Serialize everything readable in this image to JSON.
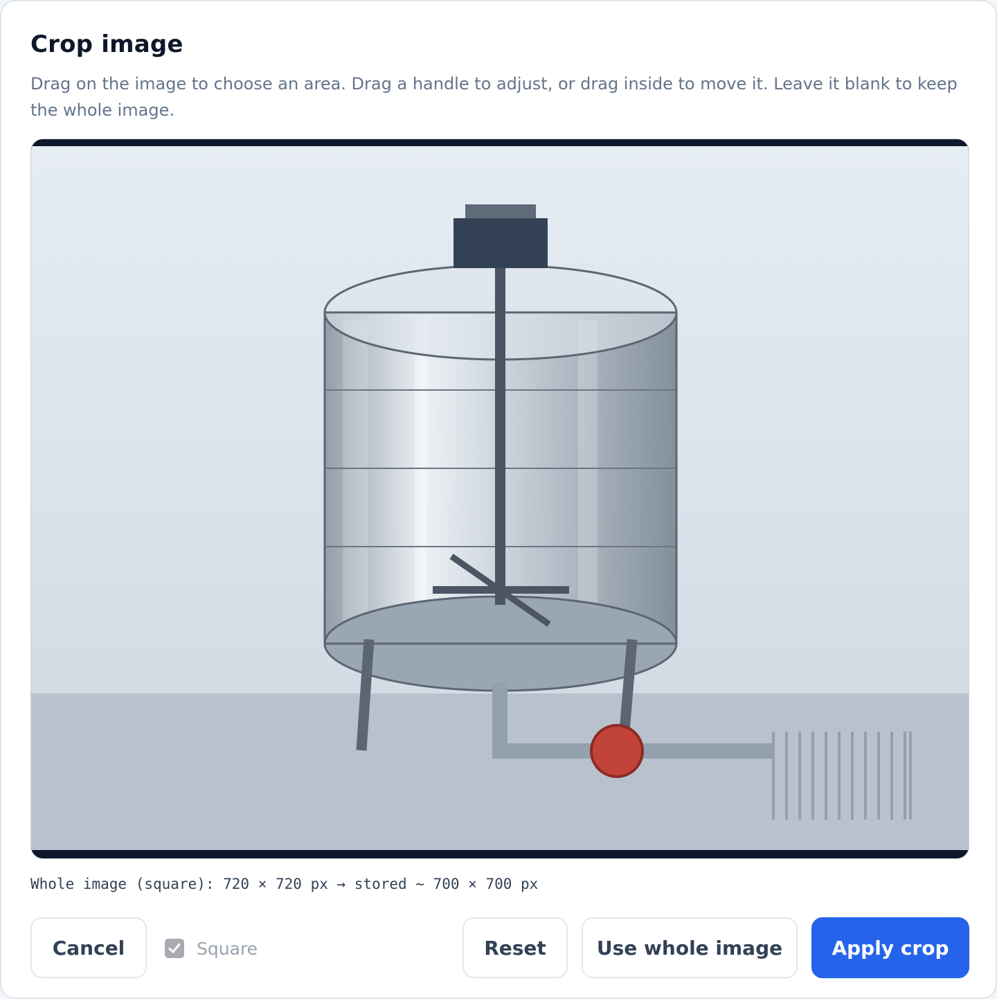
{
  "dialog": {
    "title": "Crop image",
    "description": "Drag on the image to choose an area. Drag a handle to adjust, or drag inside to move it. Leave it blank to keep the whole image."
  },
  "image": {
    "colors": {
      "sky": "#e4eaf2",
      "floor": "#b8c2cd",
      "tank_outline": "#5b6672",
      "motor": "#334155",
      "valve": "#c2433a",
      "pipe": "#94a0ad"
    }
  },
  "info": {
    "text": "Whole image (square): 720 × 720 px → stored ~ 700 × 700 px"
  },
  "controls": {
    "cancel_label": "Cancel",
    "square_label": "Square",
    "square_checked": true,
    "square_disabled": true,
    "reset_label": "Reset",
    "whole_image_label": "Use whole image",
    "apply_label": "Apply crop"
  }
}
